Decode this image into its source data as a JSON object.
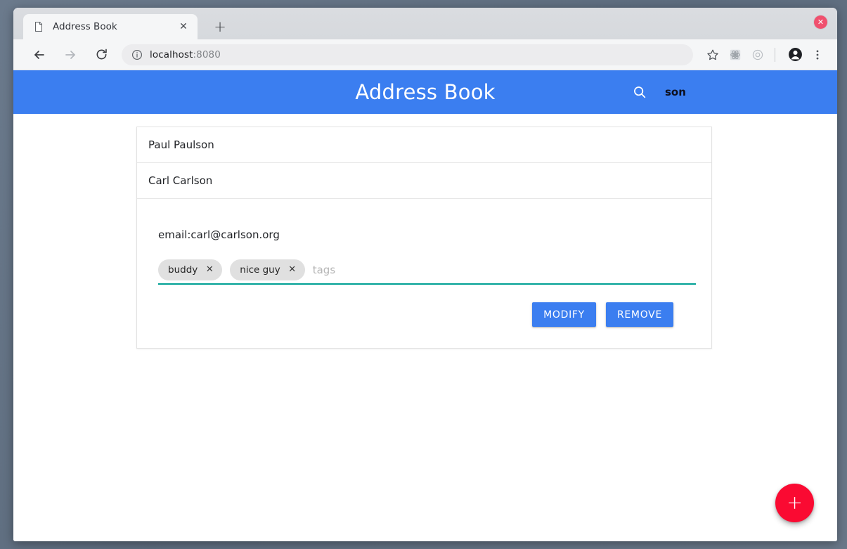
{
  "window": {
    "close_label": "✕"
  },
  "browser": {
    "tab": {
      "title": "Address Book",
      "favicon": "document-icon",
      "close_label": "✕"
    },
    "new_tab_label": "+",
    "toolbar": {
      "back_icon": "arrow-left-icon",
      "forward_icon": "arrow-right-icon",
      "reload_icon": "reload-icon",
      "info_icon": "info-circle-icon",
      "url_host": "localhost",
      "url_port": ":8080",
      "bookmark_icon": "star-icon",
      "extension_icon": "extension-icon",
      "record_icon": "record-circle-icon",
      "profile_icon": "profile-avatar-icon",
      "menu_icon": "three-dots-menu-icon"
    }
  },
  "app": {
    "header": {
      "title": "Address Book",
      "accent_color": "#3b7ef0",
      "search_icon": "search-icon",
      "search_value": "son",
      "search_placeholder": "search"
    },
    "contacts": [
      {
        "name": "Paul Paulson"
      },
      {
        "name": "Carl Carlson"
      }
    ],
    "selected_contact": {
      "name": "Carl Carlson",
      "email_line": "email:carl@carlson.org",
      "tags": [
        {
          "label": "buddy",
          "remove_label": "✕"
        },
        {
          "label": "nice guy",
          "remove_label": "✕"
        }
      ],
      "tags_placeholder": "tags",
      "tags_underline_color": "#00a094",
      "actions": {
        "modify_label": "MODIFY",
        "remove_label": "REMOVE"
      }
    },
    "fab": {
      "label": "+",
      "color": "#fa0a32",
      "icon": "plus-icon"
    }
  }
}
